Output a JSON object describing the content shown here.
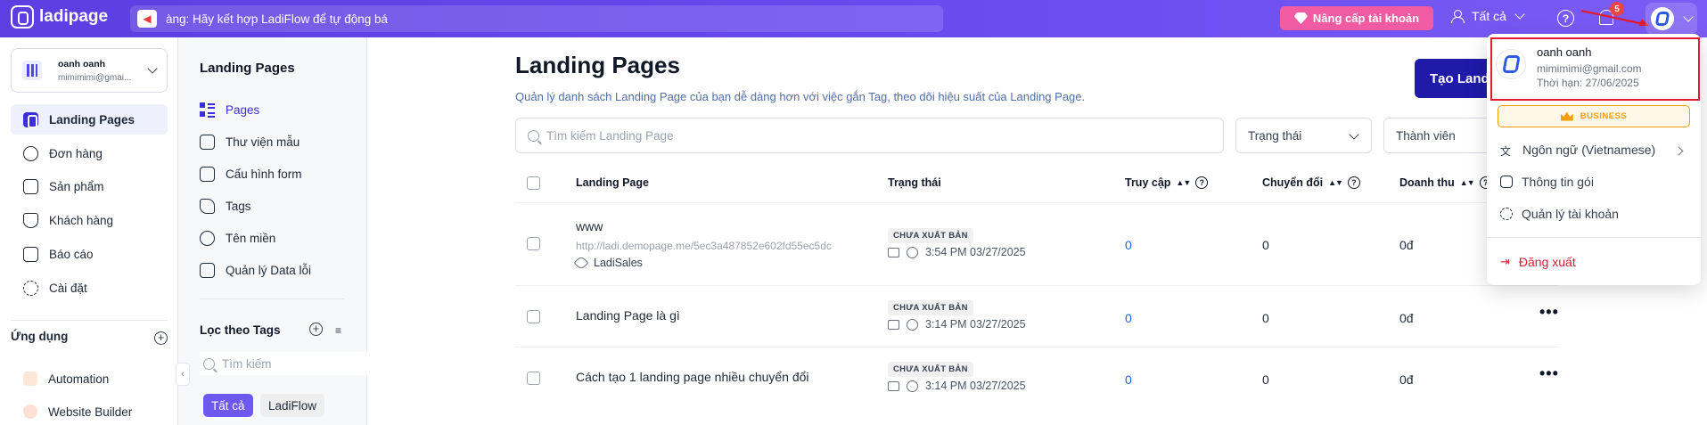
{
  "topbar": {
    "brand": "ladipage",
    "announcement": "àng: Hãy kết hợp LadiFlow để tự động bá",
    "upgrade_label": "Nâng cấp tài khoản",
    "filter_label": "Tất cả",
    "notification_count": "5"
  },
  "account": {
    "name": "oanh oanh",
    "email": "mimimimi@gmai..."
  },
  "sidebar": {
    "items": [
      {
        "label": "Landing Pages",
        "icon": "landing-pages-icon",
        "active": true
      },
      {
        "label": "Đơn hàng",
        "icon": "orders-icon"
      },
      {
        "label": "Sản phẩm",
        "icon": "products-icon"
      },
      {
        "label": "Khách hàng",
        "icon": "customers-icon"
      },
      {
        "label": "Báo cáo",
        "icon": "reports-icon"
      },
      {
        "label": "Cài đặt",
        "icon": "settings-icon"
      }
    ],
    "apps_title": "Ứng dụng",
    "apps": [
      {
        "label": "Automation",
        "icon": "automation-icon"
      },
      {
        "label": "Website Builder",
        "icon": "website-builder-icon"
      }
    ]
  },
  "subnav": {
    "title": "Landing Pages",
    "items": [
      {
        "label": "Pages",
        "active": true
      },
      {
        "label": "Thư viện mẫu"
      },
      {
        "label": "Cấu hình form"
      },
      {
        "label": "Tags"
      },
      {
        "label": "Tên miền"
      },
      {
        "label": "Quản lý Data lỗi"
      }
    ],
    "tags_title": "Lọc theo Tags",
    "tag_search_placeholder": "Tìm kiếm",
    "chips": [
      "Tất cả",
      "LadiFlow"
    ]
  },
  "main": {
    "title": "Landing Pages",
    "subtitle": "Quản lý danh sách Landing Page của bạn dễ dàng hơn với việc gắn Tag, theo dõi hiệu suất của Landing Page.",
    "create_label": "Tạo Land",
    "search_placeholder": "Tìm kiếm Landing Page",
    "status_select": "Trạng thái",
    "member_select": "Thành viên",
    "columns": [
      "Landing Page",
      "Trạng thái",
      "Truy cập",
      "Chuyển đổi",
      "Doanh thu"
    ],
    "rows": [
      {
        "name": "www",
        "url": "http://ladi.demopage.me/5ec3a487852e602fd55ec5dc",
        "tag": "LadiSales",
        "status": "CHƯA XUẤT BẢN",
        "time": "3:54 PM 03/27/2025",
        "visits": "0",
        "conversions": "0",
        "revenue": "0đ"
      },
      {
        "name": "Landing Page là gì",
        "status": "CHƯA XUẤT BẢN",
        "time": "3:14 PM 03/27/2025",
        "visits": "0",
        "conversions": "0",
        "revenue": "0đ"
      },
      {
        "name": "Cách tạo 1 landing page nhiều chuyển đổi",
        "status": "CHƯA XUẤT BẢN",
        "time": "3:14 PM 03/27/2025",
        "visits": "0",
        "conversions": "0",
        "revenue": "0đ"
      }
    ]
  },
  "dropdown": {
    "name": "oanh oanh",
    "email": "mimimimi@gmail.com",
    "expiry": "Thời hạn: 27/06/2025",
    "plan": "BUSINESS",
    "language": "Ngôn ngữ (Vietnamese)",
    "package_info": "Thông tin gói",
    "account_manage": "Quản lý tài khoản",
    "logout": "Đăng xuất"
  },
  "colors": {
    "topbar": "#5b3fe0",
    "accent": "#3b2fd6",
    "upgrade": "#f05ba3",
    "highlight": "#e11d2f"
  }
}
